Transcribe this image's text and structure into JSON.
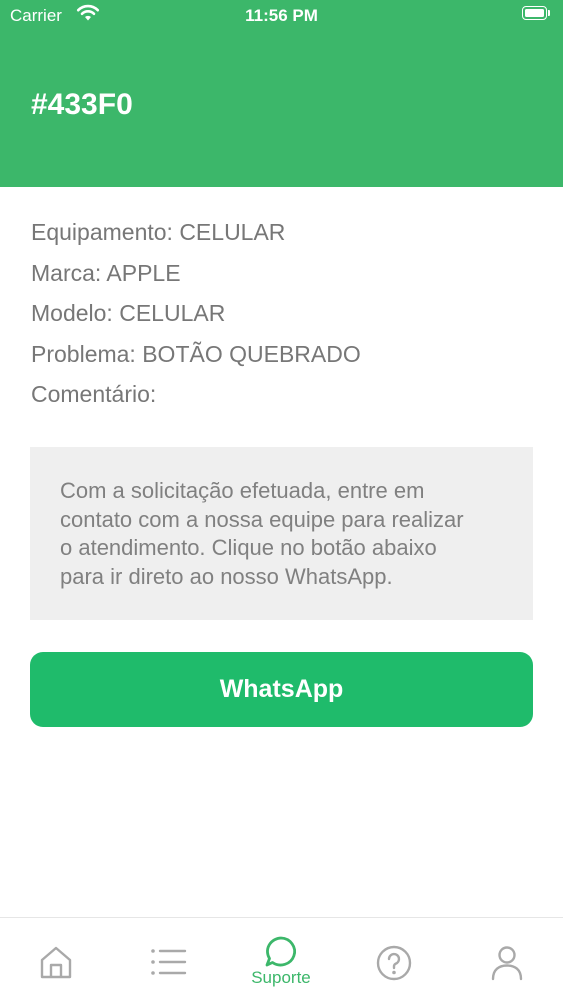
{
  "status_bar": {
    "carrier": "Carrier",
    "time": "11:56 PM"
  },
  "header": {
    "title": "#433F0",
    "background_color": "#3cb76a"
  },
  "details": [
    "Equipamento: CELULAR",
    "Marca: APPLE",
    "Modelo: CELULAR",
    "Problema: BOTÃO QUEBRADO",
    "Comentário:"
  ],
  "info_box": {
    "lines": [
      "Com a solicitação efetuada, entre em",
      "contato com a nossa equipe para realizar",
      "o atendimento. Clique no botão abaixo",
      "para ir direto ao nosso WhatsApp."
    ]
  },
  "whatsapp_button": {
    "label": "WhatsApp",
    "color": "#1fbb6b"
  },
  "tab_bar": {
    "tabs": [
      {
        "icon": "home-icon",
        "label": "",
        "active": false
      },
      {
        "icon": "list-icon",
        "label": "",
        "active": false
      },
      {
        "icon": "chat-bubble-icon",
        "label": "Suporte",
        "active": true
      },
      {
        "icon": "help-icon",
        "label": "",
        "active": false
      },
      {
        "icon": "user-icon",
        "label": "",
        "active": false
      }
    ],
    "active_color": "#3cb76a",
    "inactive_color": "#a9a9a9"
  }
}
